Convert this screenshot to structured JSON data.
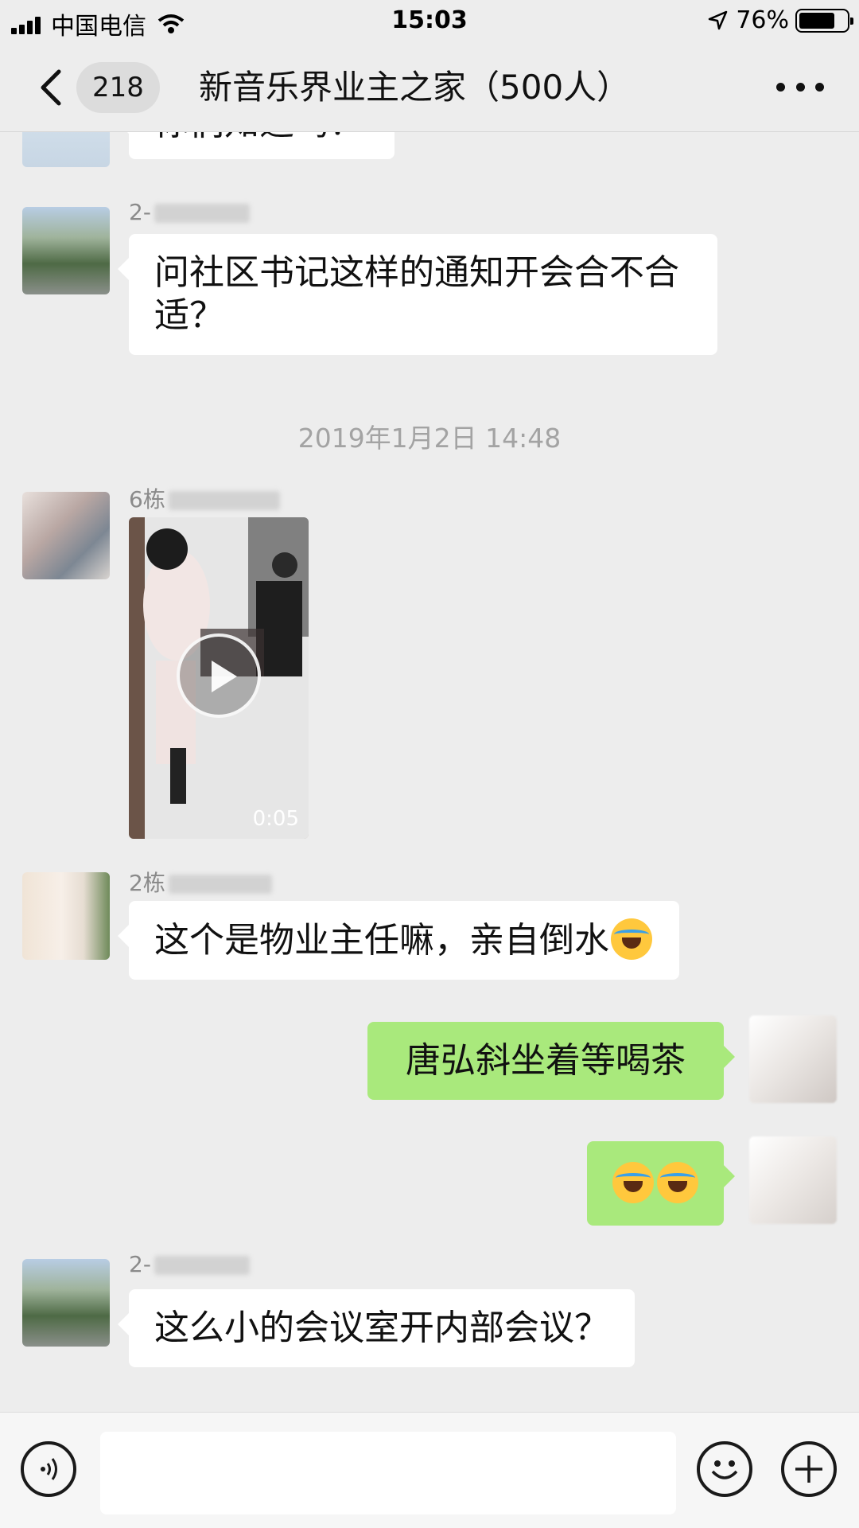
{
  "status_bar": {
    "carrier": "中国电信",
    "time": "15:03",
    "battery": "76%",
    "battery_level": 0.76
  },
  "nav": {
    "unread_count": "218",
    "title": "新音乐界业主之家（500人）"
  },
  "messages": [
    {
      "side": "left",
      "text": "你们知道吗？"
    },
    {
      "side": "left",
      "sender": "2-",
      "text": "问社区书记这样的通知开会合不合适？"
    },
    {
      "type": "timestamp",
      "text": "2019年1月2日 14:48"
    },
    {
      "side": "left",
      "sender": "6栋",
      "type": "video",
      "duration": "0:05"
    },
    {
      "side": "left",
      "sender": "2栋",
      "text": "这个是物业主任嘛，亲自倒水"
    },
    {
      "side": "right",
      "text": "唐弘斜坐着等喝茶"
    },
    {
      "side": "right",
      "type": "emoji",
      "emoji": "loudly-crying-face x2"
    },
    {
      "side": "left",
      "sender": "2-",
      "text": "这么小的会议室开内部会议？"
    }
  ],
  "input": {
    "placeholder": ""
  },
  "colors": {
    "background": "#ededed",
    "bubble_left": "#ffffff",
    "bubble_right": "#a9e97c",
    "timestamp": "#a3a3a3"
  }
}
